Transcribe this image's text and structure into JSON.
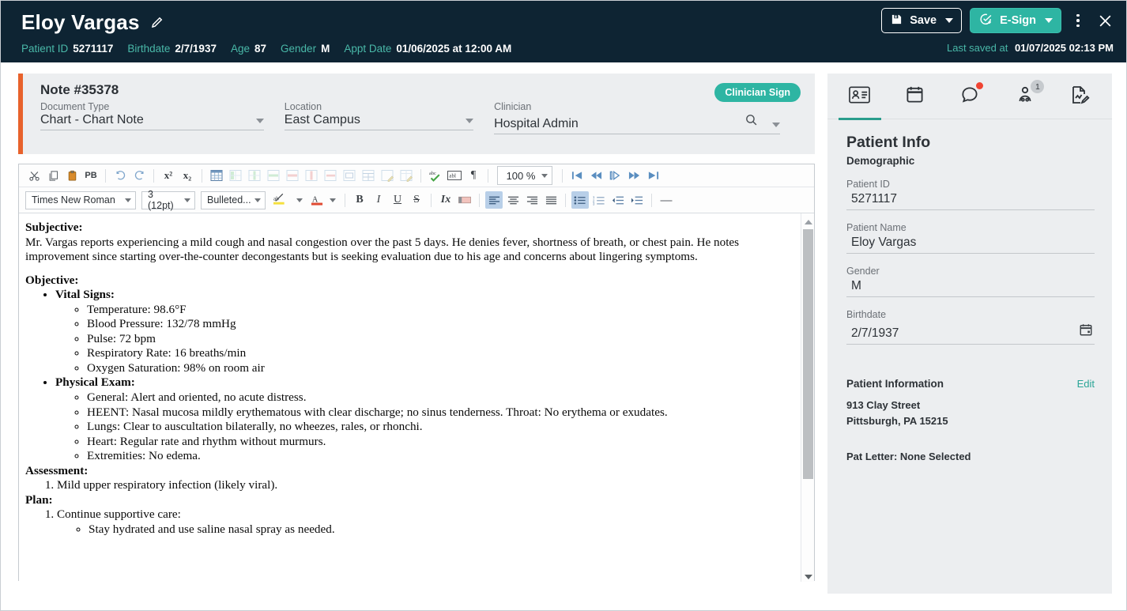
{
  "header": {
    "patient_name": "Eloy Vargas",
    "edit_icon": "pencil-icon",
    "meta": [
      {
        "label": "Patient ID",
        "value": "5271117"
      },
      {
        "label": "Birthdate",
        "value": "2/7/1937"
      },
      {
        "label": "Age",
        "value": "87"
      },
      {
        "label": "Gender",
        "value": "M"
      },
      {
        "label": "Appt Date",
        "value": "01/06/2025 at 12:00 AM"
      }
    ],
    "save_label": "Save",
    "esign_label": "E-Sign",
    "last_saved_label": "Last saved at",
    "last_saved_value": "01/07/2025 02:13 PM",
    "accent_teal": "#2eb5a3",
    "bg_navy": "#0e2433"
  },
  "note": {
    "title": "Note #35378",
    "clinician_sign_label": "Clinician Sign",
    "accent_orange": "#e8622c",
    "fields": [
      {
        "label": "Document Type",
        "value": "Chart - Chart Note"
      },
      {
        "label": "Location",
        "value": "East Campus"
      },
      {
        "label": "Clinician",
        "value": "Hospital Admin"
      }
    ]
  },
  "toolbar": {
    "row1": [
      {
        "name": "cut-icon",
        "glyph": "✂"
      },
      {
        "name": "copy-icon",
        "glyph": "⧉"
      },
      {
        "name": "paste-icon",
        "glyph": "ὌB"
      },
      {
        "name": "paste-plain-text-icon",
        "glyph": "PB"
      },
      {
        "name": "undo-icon",
        "glyph": "↶"
      },
      {
        "name": "redo-icon",
        "glyph": "↷"
      },
      {
        "name": "superscript-icon",
        "glyph": "x²"
      },
      {
        "name": "subscript-icon",
        "glyph": "x₂"
      },
      {
        "name": "insert-table-icon",
        "glyph": "table"
      },
      {
        "name": "insert-column-left-icon",
        "glyph": "table"
      },
      {
        "name": "insert-column-right-icon",
        "glyph": "table"
      },
      {
        "name": "insert-row-above-icon",
        "glyph": "table"
      },
      {
        "name": "insert-row-below-icon",
        "glyph": "table"
      },
      {
        "name": "delete-column-icon",
        "glyph": "table"
      },
      {
        "name": "delete-row-icon",
        "glyph": "table"
      },
      {
        "name": "merge-cells-icon",
        "glyph": "table"
      },
      {
        "name": "split-cell-icon",
        "glyph": "table"
      },
      {
        "name": "table-properties-icon",
        "glyph": "table"
      },
      {
        "name": "cell-properties-icon",
        "glyph": "table"
      },
      {
        "name": "spell-check-icon",
        "glyph": "abc"
      },
      {
        "name": "show-blocks-icon",
        "glyph": "abl"
      },
      {
        "name": "paragraph-mark-icon",
        "glyph": "¶"
      }
    ],
    "zoom_value": "100 %",
    "nav": [
      {
        "name": "first-page-icon"
      },
      {
        "name": "previous-page-icon"
      },
      {
        "name": "next-field-icon"
      },
      {
        "name": "next-page-icon"
      },
      {
        "name": "last-page-icon"
      }
    ],
    "row2": {
      "font_family": "Times New Roman",
      "font_size": "3 (12pt)",
      "list_style": "Bulleted...",
      "buttons": [
        {
          "name": "text-highlight-color-icon"
        },
        {
          "name": "font-color-icon"
        },
        {
          "name": "bold-icon",
          "glyph": "B"
        },
        {
          "name": "italic-icon",
          "glyph": "I"
        },
        {
          "name": "underline-icon",
          "glyph": "U"
        },
        {
          "name": "strikethrough-icon",
          "glyph": "S"
        },
        {
          "name": "remove-format-icon",
          "glyph": "Ix"
        },
        {
          "name": "text-background-icon"
        },
        {
          "name": "align-left-icon",
          "active": true
        },
        {
          "name": "align-center-icon"
        },
        {
          "name": "align-right-icon"
        },
        {
          "name": "align-justify-icon"
        },
        {
          "name": "bulleted-list-icon",
          "active": true
        },
        {
          "name": "numbered-list-icon"
        },
        {
          "name": "decrease-indent-icon"
        },
        {
          "name": "increase-indent-icon"
        },
        {
          "name": "horizontal-rule-icon",
          "glyph": "—"
        }
      ]
    }
  },
  "document": {
    "subjective_heading": "Subjective:",
    "subjective_text": "Mr. Vargas reports experiencing a mild cough and nasal congestion over the past 5 days. He denies fever, shortness of breath, or chest pain. He notes improvement since starting over-the-counter decongestants but is seeking evaluation due to his age and concerns about lingering symptoms.",
    "objective_heading": "Objective:",
    "vital_signs_heading": "Vital Signs:",
    "vital_signs": [
      "Temperature: 98.6°F",
      "Blood Pressure: 132/78 mmHg",
      "Pulse: 72 bpm",
      "Respiratory Rate: 16 breaths/min",
      "Oxygen Saturation: 98% on room air"
    ],
    "physical_exam_heading": "Physical Exam:",
    "physical_exam": [
      "General: Alert and oriented, no acute distress.",
      "HEENT: Nasal mucosa mildly erythematous with clear discharge; no sinus tenderness. Throat: No erythema or exudates.",
      "Lungs: Clear to auscultation bilaterally, no wheezes, rales, or rhonchi.",
      "Heart: Regular rate and rhythm without murmurs.",
      "Extremities: No edema."
    ],
    "assessment_heading": "Assessment:",
    "assessment_items": [
      "Mild upper respiratory infection (likely viral)."
    ],
    "plan_heading": "Plan:",
    "plan_item_1": "Continue supportive care:",
    "plan_sub_1": "Stay hydrated and use saline nasal spray as needed."
  },
  "right_panel": {
    "tabs": [
      {
        "name": "patient-card-icon",
        "active": true
      },
      {
        "name": "calendar-icon",
        "active": false
      },
      {
        "name": "chat-icon",
        "active": false,
        "dot": true
      },
      {
        "name": "care-team-icon",
        "active": false,
        "badge": "1"
      },
      {
        "name": "note-signature-icon",
        "active": false
      }
    ],
    "title": "Patient Info",
    "subtitle": "Demographic",
    "fields": [
      {
        "label": "Patient ID",
        "value": "5271117"
      },
      {
        "label": "Patient Name",
        "value": "Eloy Vargas"
      },
      {
        "label": "Gender",
        "value": "M"
      },
      {
        "label": "Birthdate",
        "value": "2/7/1937",
        "icon": "calendar-icon"
      }
    ],
    "patient_information_title": "Patient Information",
    "edit_label": "Edit",
    "address_line1": "913 Clay Street",
    "address_line2": "Pittsburgh, PA 15215",
    "pat_letter": "Pat Letter: None Selected"
  }
}
